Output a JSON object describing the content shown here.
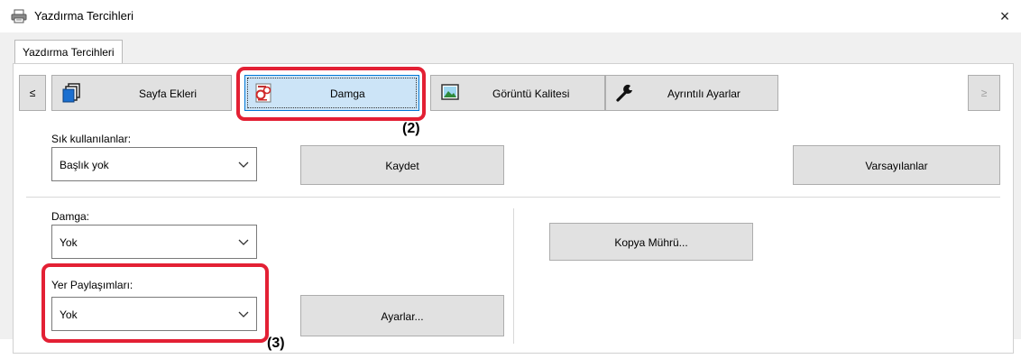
{
  "window": {
    "title": "Yazdırma Tercihleri",
    "close_glyph": "×"
  },
  "tabs": [
    {
      "label": "Yazdırma Tercihleri"
    }
  ],
  "nav": {
    "prev": "≤",
    "next": "≥"
  },
  "categories": [
    {
      "label": "Sayfa Ekleri",
      "icon": "pages-icon"
    },
    {
      "label": "Damga",
      "icon": "stamp-icon",
      "active": true
    },
    {
      "label": "Görüntü Kalitesi",
      "icon": "image-quality-icon"
    },
    {
      "label": "Ayrıntılı Ayarlar",
      "icon": "wrench-icon"
    }
  ],
  "favorites": {
    "label": "Sık kullanılanlar:",
    "value": "Başlık yok",
    "save": "Kaydet",
    "defaults": "Varsayılanlar"
  },
  "stamp": {
    "label": "Damga:",
    "value": "Yok"
  },
  "copy_seal": {
    "label": "Kopya Mührü..."
  },
  "placeholders": {
    "label": "Yer Paylaşımları:",
    "value": "Yok",
    "settings": "Ayarlar..."
  },
  "annotations": {
    "step2": "(2)",
    "step3": "(3)"
  },
  "colors": {
    "highlight": "#e32034",
    "active_button": "#cce4f7",
    "panel": "#ffffff",
    "window": "#f0f0f0"
  }
}
